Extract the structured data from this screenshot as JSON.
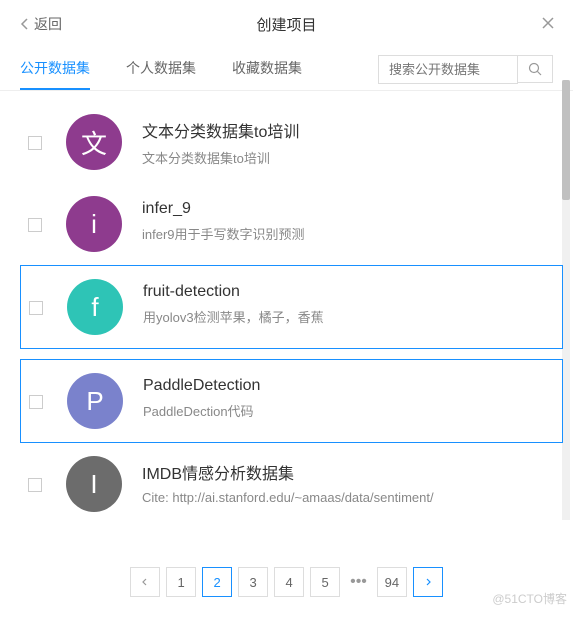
{
  "header": {
    "back": "返回",
    "title": "创建项目"
  },
  "tabs": [
    "公开数据集",
    "个人数据集",
    "收藏数据集"
  ],
  "active_tab": 0,
  "search": {
    "placeholder": "搜索公开数据集"
  },
  "datasets": [
    {
      "avatar_text": "文",
      "avatar_bg": "#8e3b8e",
      "title": "文本分类数据集to培训",
      "desc": "文本分类数据集to培训",
      "selected": false
    },
    {
      "avatar_text": "i",
      "avatar_bg": "#8e3b8e",
      "title": "infer_9",
      "desc": "infer9用于手写数字识别预测",
      "selected": false
    },
    {
      "avatar_text": "f",
      "avatar_bg": "#2ec4b6",
      "title": "fruit-detection",
      "desc": "用yolov3检测苹果，橘子，香蕉",
      "selected": true
    },
    {
      "avatar_text": "P",
      "avatar_bg": "#7a82cc",
      "title": "PaddleDetection",
      "desc": "PaddleDection代码",
      "selected": true
    },
    {
      "avatar_text": "I",
      "avatar_bg": "#6c6c6c",
      "title": "IMDB情感分析数据集",
      "desc": "Cite: http://ai.stanford.edu/~amaas/data/sentiment/",
      "selected": false
    }
  ],
  "pagination": {
    "pages": [
      "1",
      "2",
      "3",
      "4",
      "5"
    ],
    "last": "94",
    "current": "2"
  },
  "watermark": "@51CTO博客"
}
